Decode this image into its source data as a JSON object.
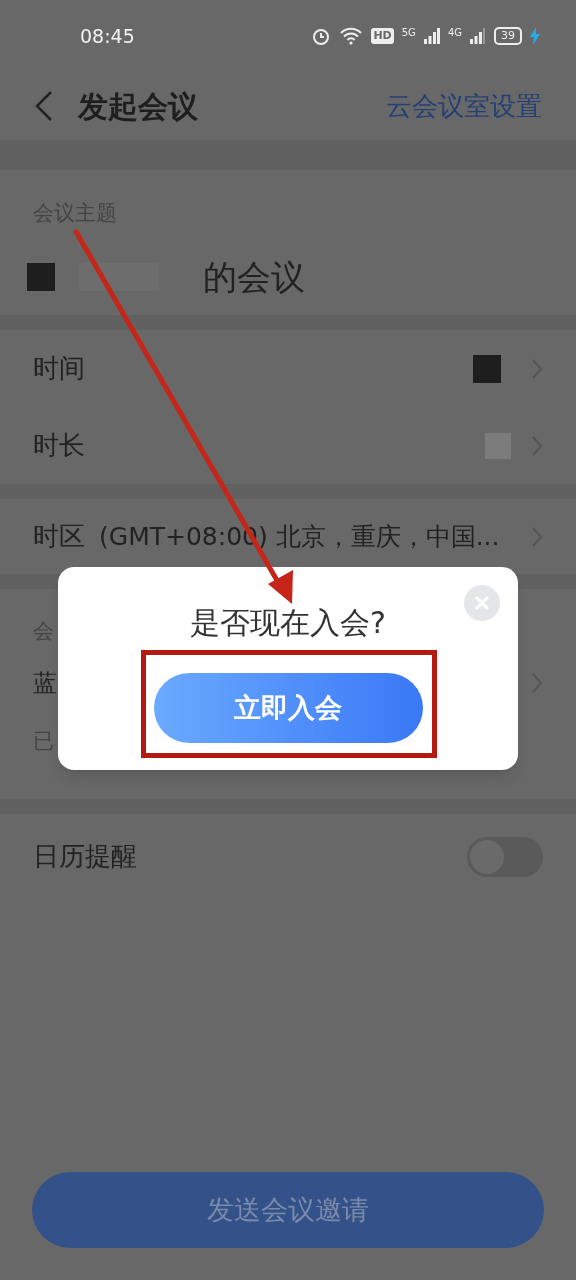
{
  "status_bar": {
    "time": "08:45",
    "hd": "HD",
    "net_5g": "5G",
    "net_4g": "4G",
    "battery": "39"
  },
  "header": {
    "title": "发起会议",
    "action": "云会议室设置"
  },
  "subject": {
    "label": "会议主题",
    "value": "的会议"
  },
  "rows": [
    {
      "kind": "nav",
      "label": "时间"
    },
    {
      "kind": "nav",
      "label": "时长"
    }
  ],
  "timezone": {
    "label": "时区",
    "value": "(GMT+08:00) 北京，重庆，中国..."
  },
  "covered_section": {
    "label": "会",
    "row": "蓝",
    "note": "已"
  },
  "calendar_reminder": {
    "label": "日历提醒",
    "on": false
  },
  "dialog": {
    "title": "是否现在入会?",
    "button": "立即入会"
  },
  "bottom_button": "发送会议邀请"
}
